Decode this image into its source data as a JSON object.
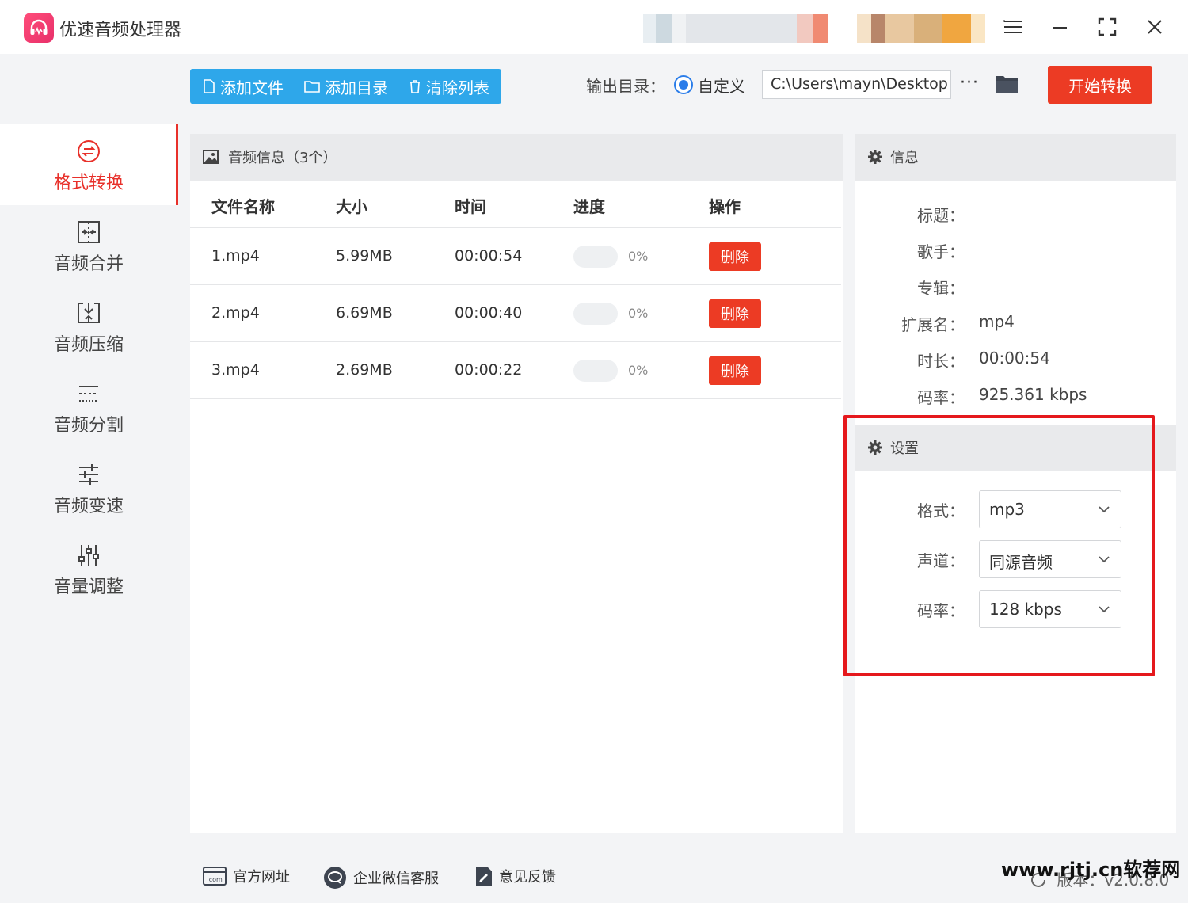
{
  "app": {
    "title": "优速音频处理器"
  },
  "window_controls": [
    "menu-icon",
    "minimize-icon",
    "fullscreen-icon",
    "close-icon"
  ],
  "sidebar": {
    "items": [
      {
        "label": "格式转换",
        "icon": "format-convert-icon",
        "active": true
      },
      {
        "label": "音频合并",
        "icon": "merge-icon",
        "active": false
      },
      {
        "label": "音频压缩",
        "icon": "compress-icon",
        "active": false
      },
      {
        "label": "音频分割",
        "icon": "split-icon",
        "active": false
      },
      {
        "label": "音频变速",
        "icon": "speed-icon",
        "active": false
      },
      {
        "label": "音量调整",
        "icon": "volume-adjust-icon",
        "active": false
      }
    ]
  },
  "toolbar": {
    "add_file": "添加文件",
    "add_dir": "添加目录",
    "clear_list": "清除列表",
    "output_label": "输出目录：",
    "radio_label": "自定义",
    "output_path": "C:\\Users\\mayn\\Desktop",
    "more": "···",
    "start": "开始转换"
  },
  "file_panel": {
    "title": "音频信息（3个）",
    "columns": [
      "文件名称",
      "大小",
      "时间",
      "进度",
      "操作"
    ],
    "rows": [
      {
        "name": "1.mp4",
        "size": "5.99MB",
        "time": "00:00:54",
        "progress": "0%",
        "action": "删除"
      },
      {
        "name": "2.mp4",
        "size": "6.69MB",
        "time": "00:00:40",
        "progress": "0%",
        "action": "删除"
      },
      {
        "name": "3.mp4",
        "size": "2.69MB",
        "time": "00:00:22",
        "progress": "0%",
        "action": "删除"
      }
    ]
  },
  "info": {
    "title": "信息",
    "fields": [
      {
        "label": "标题：",
        "value": ""
      },
      {
        "label": "歌手：",
        "value": ""
      },
      {
        "label": "专辑：",
        "value": ""
      },
      {
        "label": "扩展名：",
        "value": "mp4"
      },
      {
        "label": "时长：",
        "value": "00:00:54"
      },
      {
        "label": "码率：",
        "value": "925.361 kbps"
      }
    ]
  },
  "settings": {
    "title": "设置",
    "fields": [
      {
        "label": "格式：",
        "value": "mp3"
      },
      {
        "label": "声道：",
        "value": "同源音频"
      },
      {
        "label": "码率：",
        "value": "128 kbps"
      }
    ]
  },
  "bottom": {
    "website": "官方网址",
    "wechat": "企业微信客服",
    "feedback": "意见反馈",
    "version": "版本：v2.0.8.0"
  },
  "watermark": "www.rjtj.cn软荐网",
  "colors": {
    "accent_red": "#ec3b24",
    "toolbar_blue": "#2ea7ea",
    "radio_blue": "#2b7de9",
    "highlight_red": "#e5181c"
  }
}
